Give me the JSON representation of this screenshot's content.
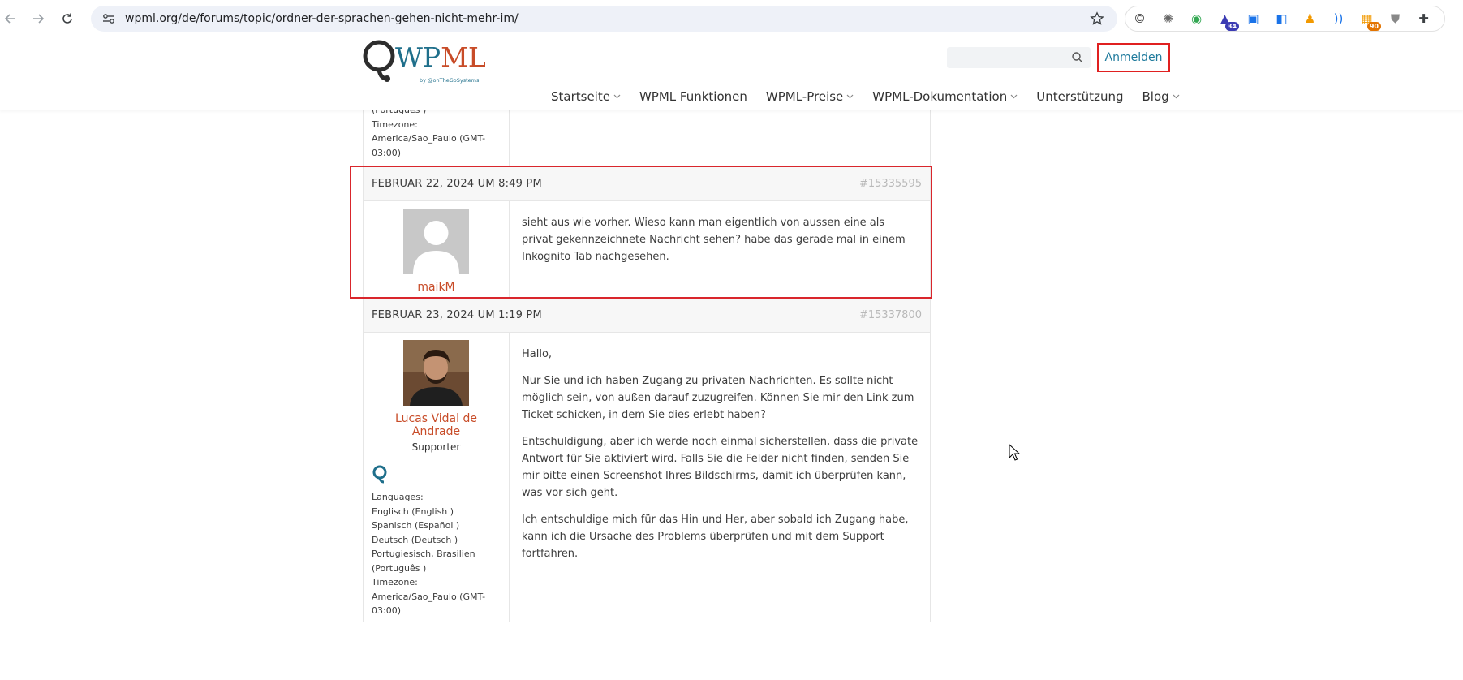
{
  "browser": {
    "url": "wpml.org/de/forums/topic/ordner-der-sprachen-gehen-nicht-mehr-im/",
    "extensions": [
      {
        "icon": "copyright-icon",
        "color": "#333333"
      },
      {
        "icon": "gear-extension-icon",
        "color": "#666666"
      },
      {
        "icon": "spiral-extension-icon",
        "color": "#34a853"
      },
      {
        "icon": "graduation-cap-icon",
        "color": "#3b3bb3",
        "badge": "34",
        "badge_color": "#3b3bb3"
      },
      {
        "icon": "screenshot-extension-icon",
        "color": "#1a73e8"
      },
      {
        "icon": "code-tag-icon",
        "color": "#1a73e8"
      },
      {
        "icon": "bell-extension-icon",
        "color": "#f29900"
      },
      {
        "icon": "wifi-extension-icon",
        "color": "#1a73e8"
      },
      {
        "icon": "chart-extension-icon",
        "color": "#f29900",
        "badge": "90",
        "badge_color": "#e37400"
      },
      {
        "icon": "shield-extension-icon",
        "color": "#888888"
      },
      {
        "icon": "puzzle-icon",
        "color": "#3c4043"
      }
    ]
  },
  "header": {
    "logo_text": "WPML",
    "logo_sub": "by @onTheGoSystems",
    "search_placeholder": "",
    "login_label": "Anmelden",
    "nav": [
      {
        "label": "Startseite",
        "dropdown": true
      },
      {
        "label": "WPML Funktionen",
        "dropdown": false
      },
      {
        "label": "WPML-Preise",
        "dropdown": true
      },
      {
        "label": "WPML-Dokumentation",
        "dropdown": true
      },
      {
        "label": "Unterstützung",
        "dropdown": false
      },
      {
        "label": "Blog",
        "dropdown": true
      }
    ]
  },
  "previous_post_tail": {
    "lines": [
      "(Português )",
      "Timezone:",
      "America/Sao_Paulo (GMT-",
      "03:00)"
    ]
  },
  "posts": [
    {
      "date": "FEBRUAR 22, 2024 UM 8:49 PM",
      "id": "#15335595",
      "author": "maikM",
      "role": "",
      "paragraphs": [
        "sieht aus wie vorher. Wieso kann man eigentlich von aussen eine als privat gekennzeichnete Nachricht sehen? habe das gerade mal in einem Inkognito Tab nachgesehen."
      ]
    },
    {
      "date": "FEBRUAR 23, 2024 UM 1:19 PM",
      "id": "#15337800",
      "author": "Lucas Vidal de Andrade",
      "role": "Supporter",
      "languages_label": "Languages:",
      "languages": [
        "Englisch (English )",
        "Spanisch (Español )",
        "Deutsch (Deutsch )",
        "Portugiesisch, Brasilien",
        "(Português )"
      ],
      "timezone_label": "Timezone:",
      "timezone": [
        "America/Sao_Paulo (GMT-",
        "03:00)"
      ],
      "paragraphs": [
        "Hallo,",
        "Nur Sie und ich haben Zugang zu privaten Nachrichten. Es sollte nicht möglich sein, von außen darauf zuzugreifen. Können Sie mir den Link zum Ticket schicken, in dem Sie dies erlebt haben?",
        "Entschuldigung, aber ich werde noch einmal sicherstellen, dass die private Antwort für Sie aktiviert wird. Falls Sie die Felder nicht finden, senden Sie mir bitte einen Screenshot Ihres Bildschirms, damit ich überprüfen kann, was vor sich geht.",
        "Ich entschuldige mich für das Hin und Her, aber sobald ich Zugang habe, kann ich die Ursache des Problems überprüfen und mit dem Support fortfahren."
      ]
    }
  ],
  "colors": {
    "accent_link": "#1e7a9c",
    "author_link": "#c84c28",
    "highlight": "#d9262c"
  }
}
